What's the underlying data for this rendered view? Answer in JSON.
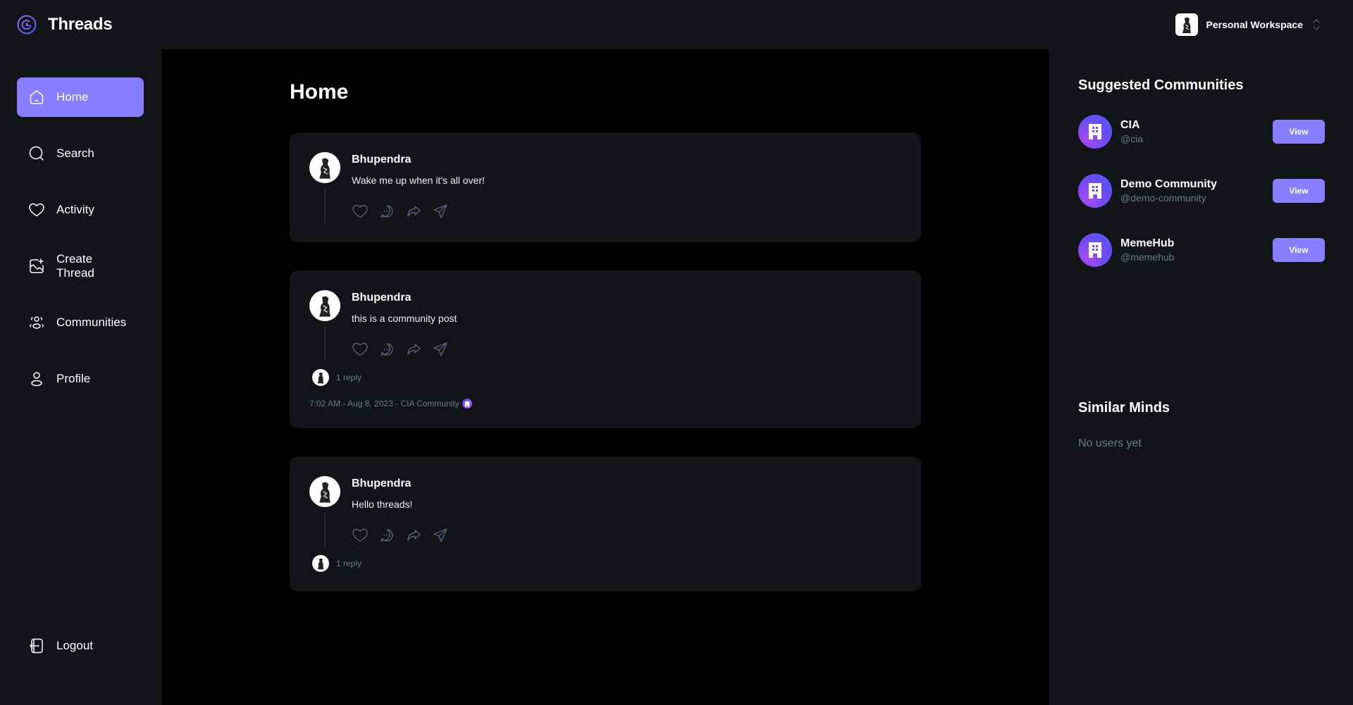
{
  "app": {
    "title": "Threads",
    "workspace": "Personal Workspace"
  },
  "sidebar": {
    "items": [
      {
        "label": "Home",
        "icon": "home-icon",
        "active": true
      },
      {
        "label": "Search",
        "icon": "search-icon",
        "active": false
      },
      {
        "label": "Activity",
        "icon": "heart-icon",
        "active": false
      },
      {
        "label": "Create Thread",
        "icon": "create-image-icon",
        "active": false
      },
      {
        "label": "Communities",
        "icon": "communities-icon",
        "active": false
      },
      {
        "label": "Profile",
        "icon": "user-icon",
        "active": false
      }
    ],
    "logout": "Logout"
  },
  "main": {
    "title": "Home",
    "threads": [
      {
        "author": "Bhupendra",
        "content": "Wake me up when it's all over!",
        "replies": null,
        "meta": null
      },
      {
        "author": "Bhupendra",
        "content": "this is a community post",
        "replies": "1 reply",
        "meta": "7:02 AM - Aug 8, 2023 - CIA Community"
      },
      {
        "author": "Bhupendra",
        "content": "Hello threads!",
        "replies": "1 reply",
        "meta": null
      }
    ]
  },
  "rightbar": {
    "suggested_title": "Suggested Communities",
    "communities": [
      {
        "name": "CIA",
        "handle": "@cia",
        "button": "View"
      },
      {
        "name": "Demo Community",
        "handle": "@demo-community",
        "button": "View"
      },
      {
        "name": "MemeHub",
        "handle": "@memehub",
        "button": "View"
      }
    ],
    "similar_title": "Similar Minds",
    "similar_empty": "No users yet"
  },
  "colors": {
    "accent": "#877EFF",
    "panel": "#121417",
    "muted": "#697C89",
    "background": "#000000"
  }
}
